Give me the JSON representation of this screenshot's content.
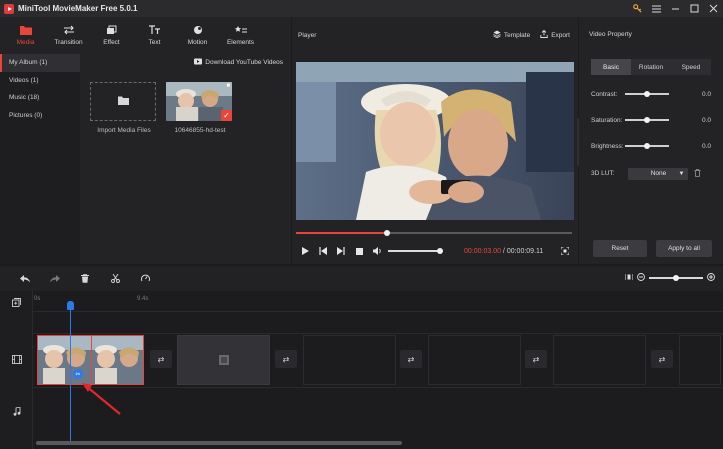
{
  "app": {
    "title": "MiniTool MovieMaker Free 5.0.1"
  },
  "toolbar": {
    "tabs": [
      {
        "label": "Media",
        "icon": "media-folder-icon",
        "active": true
      },
      {
        "label": "Transition",
        "icon": "transition-arrows-icon",
        "active": false
      },
      {
        "label": "Effect",
        "icon": "effect-layers-icon",
        "active": false
      },
      {
        "label": "Text",
        "icon": "text-tt-icon",
        "active": false
      },
      {
        "label": "Motion",
        "icon": "motion-icon",
        "active": false
      },
      {
        "label": "Elements",
        "icon": "elements-icon",
        "active": false
      }
    ]
  },
  "sidebar": {
    "items": [
      {
        "label": "My Album (1)",
        "active": true
      },
      {
        "label": "Videos (1)",
        "active": false
      },
      {
        "label": "Music (18)",
        "active": false
      },
      {
        "label": "Pictures (0)",
        "active": false
      }
    ]
  },
  "media": {
    "download_label": "Download YouTube Videos",
    "import_label": "Import Media Files",
    "clip_name": "10646855-hd-test"
  },
  "player": {
    "header": "Player",
    "template_label": "Template",
    "export_label": "Export",
    "progress": 0.33,
    "current_time": "00:00:03.00",
    "separator": " / ",
    "total_time": "00:00:09.11"
  },
  "property": {
    "header": "Video Property",
    "tabs": [
      {
        "label": "Basic",
        "active": true
      },
      {
        "label": "Rotation",
        "active": false
      },
      {
        "label": "Speed",
        "active": false
      }
    ],
    "sliders": [
      {
        "label": "Contrast:",
        "value": "0.0",
        "level": 0.5
      },
      {
        "label": "Saturation:",
        "value": "0.0",
        "level": 0.5
      },
      {
        "label": "Brightness:",
        "value": "0.0",
        "level": 0.5
      }
    ],
    "lut_label": "3D LUT:",
    "lut_value": "None",
    "reset_label": "Reset",
    "apply_label": "Apply to all"
  },
  "timeline": {
    "ruler_start": "0s",
    "ruler_mark": "9.4s",
    "zoom_level": 0.5
  },
  "colors": {
    "accent": "#e8463a",
    "playhead": "#2b7ae8",
    "panel": "#232326"
  }
}
